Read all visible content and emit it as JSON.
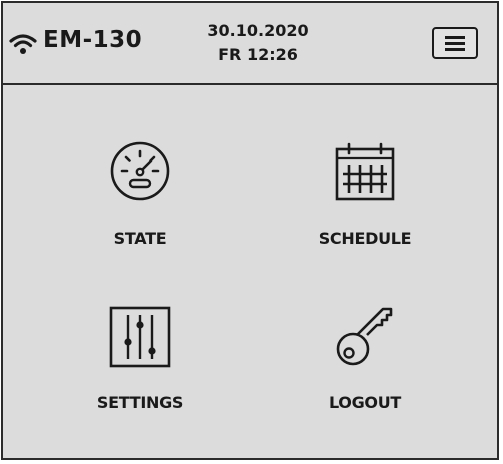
{
  "header": {
    "device_name": "EM-130",
    "date": "30.10.2020",
    "day_time": "FR 12:26",
    "icons": {
      "connection": "wifi-icon",
      "menu": "hamburger-menu-icon"
    }
  },
  "tiles": [
    {
      "label": "STATE",
      "icon": "gauge-icon"
    },
    {
      "label": "SCHEDULE",
      "icon": "calendar-icon"
    },
    {
      "label": "SETTINGS",
      "icon": "sliders-icon"
    },
    {
      "label": "LOGOUT",
      "icon": "key-icon"
    }
  ],
  "colors": {
    "background": "#dcdcdc",
    "foreground": "#1a1a1a"
  }
}
